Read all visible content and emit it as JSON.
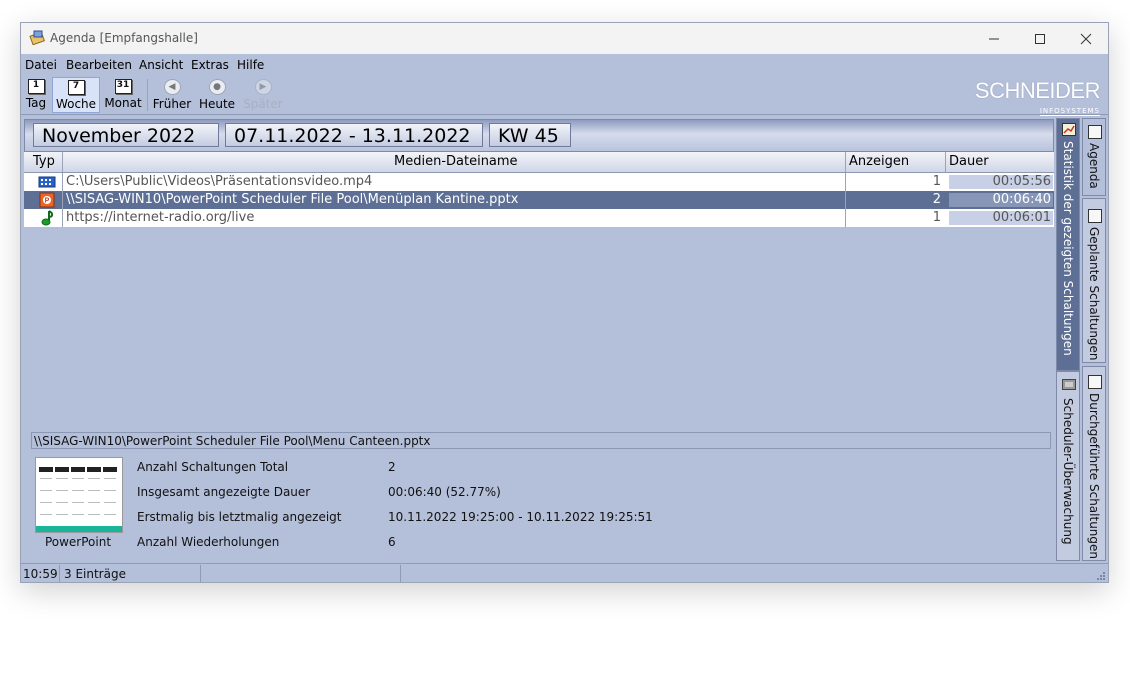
{
  "window": {
    "title": "Agenda [Empfangshalle]"
  },
  "menu": [
    "Datei",
    "Bearbeiten",
    "Ansicht",
    "Extras",
    "Hilfe"
  ],
  "toolbar": {
    "tag": "Tag",
    "tag_num": "1",
    "woche": "Woche",
    "woche_num": "7",
    "monat": "Monat",
    "monat_num": "31",
    "frueher": "Früher",
    "heute": "Heute",
    "spaeter": "Später"
  },
  "logo": {
    "name": "SCHNEIDER",
    "sub": "INFOSYSTEMS"
  },
  "header": {
    "month": "November 2022",
    "range": "07.11.2022 - 13.11.2022",
    "week": "KW 45"
  },
  "columns": {
    "typ": "Typ",
    "name": "Medien-Dateiname",
    "anzeigen": "Anzeigen",
    "dauer": "Dauer"
  },
  "rows": [
    {
      "type_icon": "video-icon",
      "name": "C:\\Users\\Public\\Videos\\Präsentationsvideo.mp4",
      "count": "1",
      "duration": "00:05:56",
      "selected": false
    },
    {
      "type_icon": "powerpoint-icon",
      "name": "\\\\SISAG-WIN10\\PowerPoint Scheduler File Pool\\Menüplan Kantine.pptx",
      "count": "2",
      "duration": "00:06:40",
      "selected": true
    },
    {
      "type_icon": "music-note-icon",
      "name": "https://internet-radio.org/live",
      "count": "1",
      "duration": "00:06:01",
      "selected": false
    }
  ],
  "detail": {
    "path": "\\\\SISAG-WIN10\\PowerPoint Scheduler File Pool\\Menu Canteen.pptx",
    "thumb_label": "PowerPoint",
    "stats": [
      {
        "label": "Anzahl Schaltungen Total",
        "value": "2"
      },
      {
        "label": "Insgesamt angezeigte Dauer",
        "value": "00:06:40 (52.77%)"
      },
      {
        "label": "Erstmalig bis letztmalig angezeigt",
        "value": "10.11.2022 19:25:00 - 10.11.2022 19:25:51"
      },
      {
        "label": "Anzahl Wiederholungen",
        "value": "6"
      }
    ]
  },
  "tabs": {
    "statistik": "Statistik der gezeigten Schaltungen",
    "scheduler": "Scheduler-Überwachung",
    "agenda": "Agenda",
    "geplante": "Geplante Schaltungen",
    "durchgefuehrte": "Durchgeführte Schaltungen"
  },
  "status": {
    "time": "10:59",
    "entries": "3 Einträge"
  },
  "colors": {
    "background": "#b4bfd9",
    "selection": "#5d6f94",
    "header": "#d6dcec"
  }
}
